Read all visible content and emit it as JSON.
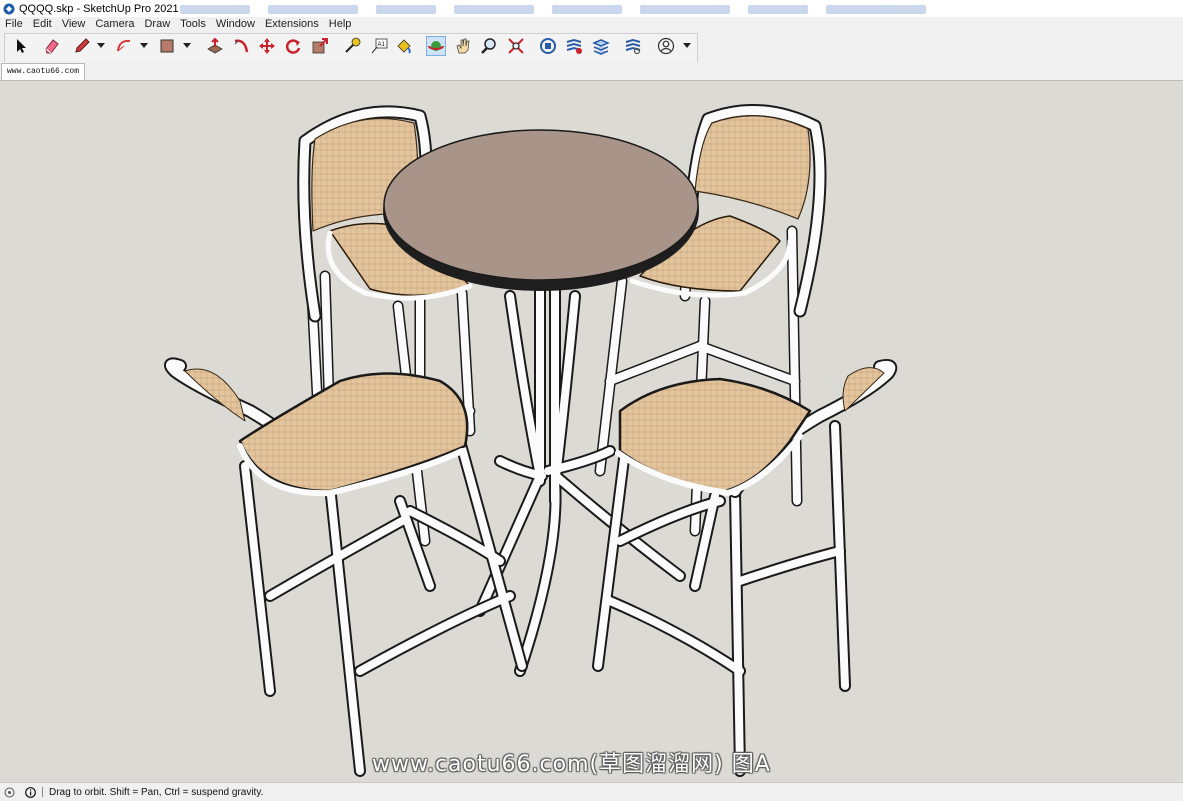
{
  "window": {
    "title": "QQQQ.skp - SketchUp Pro 2021"
  },
  "menu": {
    "items": [
      "File",
      "Edit",
      "View",
      "Camera",
      "Draw",
      "Tools",
      "Window",
      "Extensions",
      "Help"
    ]
  },
  "toolbar": {
    "tools": [
      {
        "name": "select",
        "icon": "select-arrow-icon"
      },
      {
        "name": "eraser",
        "icon": "eraser-icon"
      },
      {
        "name": "line",
        "icon": "pencil-icon"
      },
      {
        "name": "arc",
        "icon": "arc-icon"
      },
      {
        "name": "rectangle",
        "icon": "rectangle-icon"
      },
      {
        "name": "push-pull",
        "icon": "push-pull-icon"
      },
      {
        "name": "follow-me",
        "icon": "follow-me-icon"
      },
      {
        "name": "move",
        "icon": "move-icon"
      },
      {
        "name": "rotate",
        "icon": "rotate-icon"
      },
      {
        "name": "scale",
        "icon": "scale-icon"
      },
      {
        "name": "tape-measure",
        "icon": "tape-measure-icon"
      },
      {
        "name": "text",
        "icon": "text-icon"
      },
      {
        "name": "paint-bucket",
        "icon": "paint-bucket-icon"
      },
      {
        "name": "orbit",
        "icon": "orbit-icon",
        "active": true
      },
      {
        "name": "pan",
        "icon": "pan-hand-icon"
      },
      {
        "name": "zoom",
        "icon": "zoom-icon"
      },
      {
        "name": "zoom-extents",
        "icon": "zoom-extents-icon"
      },
      {
        "name": "3d-warehouse",
        "icon": "warehouse-icon"
      },
      {
        "name": "extension-warehouse",
        "icon": "extension-warehouse-icon"
      },
      {
        "name": "layout",
        "icon": "layout-icon"
      },
      {
        "name": "extension-manager",
        "icon": "extension-manager-icon"
      },
      {
        "name": "account",
        "icon": "user-account-icon"
      }
    ]
  },
  "scene_tab": {
    "label": "www.caotu66.com"
  },
  "watermark": {
    "text": "www.caotu66.com(草图溜溜网) 图A"
  },
  "status": {
    "text": "Drag to orbit. Shift = Pan, Ctrl = suspend gravity."
  },
  "colors": {
    "viewport_bg": "#dcdad4",
    "table_top": "#a89488",
    "rattan": "#e2c29c",
    "frame": "#fbfbfb",
    "outline": "#1a1a1a"
  }
}
